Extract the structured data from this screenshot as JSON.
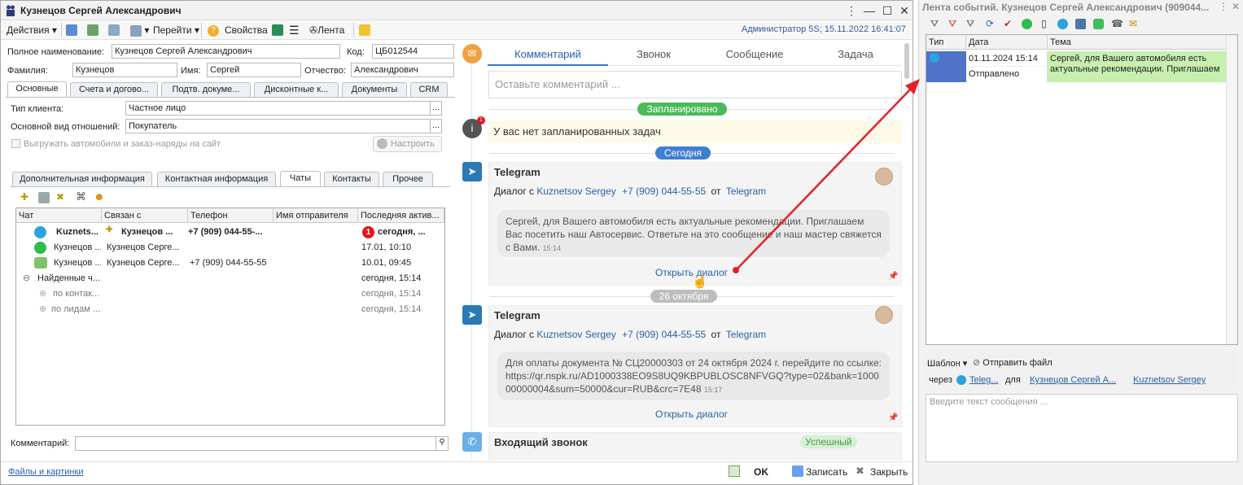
{
  "window": {
    "title": "Кузнецов Сергей Александрович",
    "admin_info": "Администратор 5S; 15.11.2022 16:41:07"
  },
  "toolbar": {
    "actions": "Действия",
    "goto": "Перейти",
    "properties": "Свойства",
    "feed": "Лента"
  },
  "form": {
    "full_name_label": "Полное наименование:",
    "full_name_value": "Кузнецов Сергей Александрович",
    "code_label": "Код:",
    "code_value": "ЦБ012544",
    "last_name_label": "Фамилия:",
    "last_name_value": "Кузнецов",
    "first_name_label": "Имя:",
    "first_name_value": "Сергей",
    "patronymic_label": "Отчество:",
    "patronymic_value": "Александрович"
  },
  "main_tabs": [
    "Основные",
    "Счета и догово...",
    "Подтв. докуме...",
    "Дисконтные к...",
    "Документы",
    "CRM"
  ],
  "basics": {
    "client_type_label": "Тип клиента:",
    "client_type_value": "Частное лицо",
    "relation_label": "Основной вид отношений:",
    "relation_value": "Покупатель",
    "export_checkbox": "Выгружать автомобили и заказ-наряды на сайт",
    "configure_button": "Настроить"
  },
  "sub_tabs": [
    "Дополнительная информация",
    "Контактная информация",
    "Чаты",
    "Контакты",
    "Прочее"
  ],
  "chats": {
    "columns": [
      "Чат",
      "Связан с",
      "Телефон",
      "Имя отправителя",
      "Последняя актив..."
    ],
    "rows": [
      {
        "chat": "Kuznets...",
        "linked": "Кузнецов ...",
        "phone": "+7 (909) 044-55-...",
        "sender": "",
        "badge": "1",
        "last": "сегодня, ...",
        "bold": true
      },
      {
        "chat": "Кузнецов ...",
        "linked": "Кузнецов Серге...",
        "phone": "",
        "sender": "",
        "badge": "",
        "last": "17.01, 10:10",
        "bold": false
      },
      {
        "chat": "Кузнецов ...",
        "linked": "Кузнецов Серге...",
        "phone": "+7 (909) 044-55-55",
        "sender": "",
        "badge": "",
        "last": "10.01, 09:45",
        "bold": false
      }
    ],
    "group": {
      "label": "Найденные ч...",
      "last": "сегодня, 15:14"
    },
    "subgroups": [
      {
        "label": "по контак...",
        "last": "сегодня, 15:14"
      },
      {
        "label": "по лидам ...",
        "last": "сегодня, 15:14"
      }
    ]
  },
  "comment_label": "Комментарий:",
  "footer": {
    "files_link": "Файлы и картинки",
    "ok": "OK",
    "save": "Записать",
    "close": "Закрыть"
  },
  "feed": {
    "tabs": [
      "Комментарий",
      "Звонок",
      "Сообщение",
      "Задача"
    ],
    "comment_placeholder": "Оставьте комментарий ...",
    "planned_pill": "Запланировано",
    "no_tasks": "У вас нет запланированных задач",
    "notify_badge": "1",
    "today_pill": "Сегодня",
    "date_pill": "26 октября",
    "card1": {
      "title": "Telegram",
      "dialog_prefix": "Диалог с",
      "user": "Kuznetsov Sergey",
      "phone": "+7 (909) 044-55-55",
      "from": "от",
      "channel": "Telegram",
      "message": "Сергей, для Вашего автомобиля есть актуальные рекомендации. Приглашаем Вас посетить наш Автосервис. Ответьте на это сообщение и наш мастер свяжется с Вами.",
      "time": "15:14",
      "open": "Открыть диалог"
    },
    "card2": {
      "title": "Telegram",
      "dialog_prefix": "Диалог с",
      "user": "Kuznetsov Sergey",
      "phone": "+7 (909) 044-55-55",
      "from": "от",
      "channel": "Telegram",
      "message": "Для оплаты документа № СЦ20000303 от 24 октября 2024 г. перейдите по ссылке: https://qr.nspk.ru/AD1000338EO9S8UQ9KBPUBLOSC8NFVGQ?type=02&bank=100000000004&sum=50000&cur=RUB&crc=7E48",
      "time": "15:17",
      "open": "Открыть диалог"
    },
    "card3": {
      "title": "Входящий звонок",
      "status": "Успешный"
    }
  },
  "events_panel": {
    "title": "Лента событий. Кузнецов Сергей Александрович (909044...",
    "columns": [
      "Тип",
      "Дата",
      "Тема"
    ],
    "row": {
      "date": "01.11.2024 15:14",
      "status": "Отправлено",
      "topic": "Сергей, для Вашего автомобиля есть актуальные рекомендации. Приглашаем"
    },
    "template": "Шаблон",
    "send_file": "Отправить файл",
    "via": "через",
    "via_channel": "Teleg...",
    "for": "для",
    "for_contact": "Кузнецов Сергей А...",
    "recipient": "Kuznetsov Sergey",
    "message_placeholder": "Введите текст сообщения ..."
  },
  "colors": {
    "accent": "#3576c9",
    "green_pill": "#4cba5a",
    "today_pill": "#3f7fd0",
    "date_pill": "#bdbdbd",
    "arrow": "#e3202a",
    "row_green": "#c6efb0",
    "row_blue": "#4e73c9"
  }
}
